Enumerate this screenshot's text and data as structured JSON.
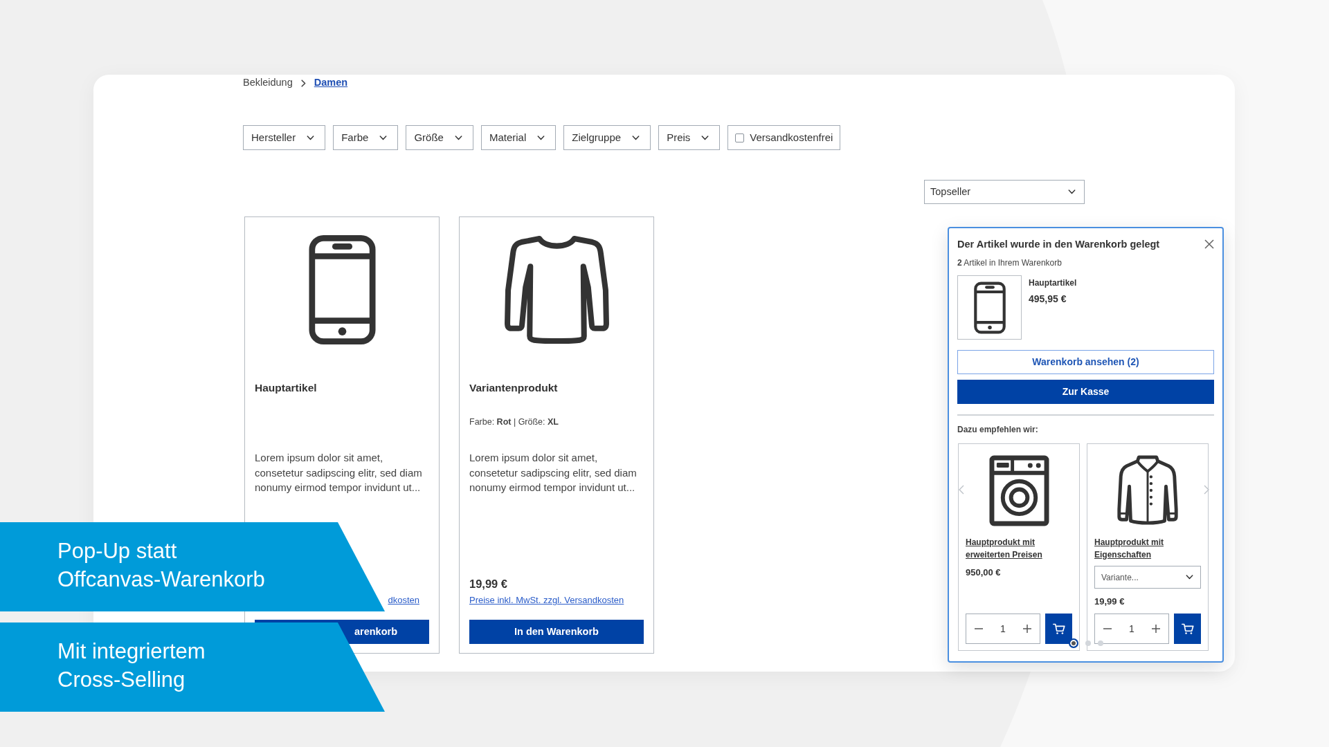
{
  "breadcrumb": [
    {
      "label": "Bekleidung",
      "active": false
    },
    {
      "label": "Damen",
      "active": true
    }
  ],
  "filters": [
    {
      "kind": "dropdown",
      "label": "Hersteller"
    },
    {
      "kind": "dropdown",
      "label": "Farbe"
    },
    {
      "kind": "dropdown",
      "label": "Größe"
    },
    {
      "kind": "dropdown",
      "label": "Material"
    },
    {
      "kind": "dropdown",
      "label": "Zielgruppe"
    },
    {
      "kind": "dropdown",
      "label": "Preis"
    },
    {
      "kind": "checkbox",
      "label": "Versandkostenfrei",
      "checked": false
    }
  ],
  "sort_select": {
    "value": "Topseller"
  },
  "products": [
    {
      "name": "Hauptartikel",
      "description": "Lorem ipsum dolor sit amet, consetetur sadipscing elitr, sed diam nonumy eirmod tempor invidunt ut...",
      "price_note": "dkosten",
      "button": "arenkorb"
    },
    {
      "name": "Variantenprodukt",
      "variant": "Farbe: **Rot** | Größe: **XL**",
      "description": "Lorem ipsum dolor sit amet, consetetur sadipscing elitr, sed diam nonumy eirmod tempor invidunt ut...",
      "price": "19,99 €",
      "price_note": "Preise inkl. MwSt. zzgl. Versandkosten",
      "button": "In den Warenkorb"
    }
  ],
  "cart_popup": {
    "title": "Der Artikel wurde in den Warenkorb gelegt",
    "count": "**2** Artikel in Ihrem Warenkorb",
    "item": {
      "name": "Hauptartikel",
      "price": "495,95 €"
    },
    "buttons": [
      {
        "kind": "outline",
        "label": "Warenkorb ansehen (2)"
      },
      {
        "kind": "primary",
        "label": "Zur Kasse"
      }
    ],
    "recommendations_title": "Dazu empfehlen wir:",
    "recommendations": [
      {
        "name": "Hauptprodukt mit erweiterten Preisen",
        "price": "950,00 €",
        "quantity": "1"
      },
      {
        "name": "Hauptprodukt mit Eigenschaften",
        "variant_select": {
          "placeholder": "Variante..."
        },
        "price": "19,99 €",
        "quantity": "1"
      }
    ],
    "carousel_dots": [
      {
        "selected": true
      },
      {
        "selected": false
      },
      {
        "selected": false
      }
    ]
  },
  "banners": [
    {
      "lines": [
        "Pop-Up statt",
        "Offcanvas-Warenkorb"
      ]
    },
    {
      "lines": [
        "Mit integriertem",
        "Cross-Selling"
      ]
    }
  ]
}
